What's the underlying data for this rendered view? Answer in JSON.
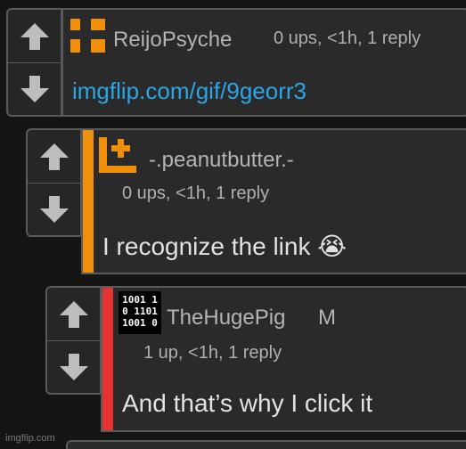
{
  "comments": [
    {
      "username": "ReijoPsyche",
      "meta": "0 ups, <1h, 1 reply",
      "text": "imgflip.com/gif/9georr3",
      "text_is_link": true,
      "avatar": "orange-blocks-icon",
      "accent_color": "#f0900a"
    },
    {
      "username": "-.peanutbutter.-",
      "meta": "0 ups, <1h, 1 reply",
      "text": "I recognize the link",
      "emoji": "😭",
      "avatar": "orange-plus-icon",
      "accent_color": "#f0900a"
    },
    {
      "username": "TheHugePig",
      "mod_badge": "M",
      "meta": "1 up, <1h, 1 reply",
      "text": "And that’s why I click it",
      "avatar": "binary-pixel-icon",
      "accent_color": "#e83232"
    }
  ],
  "watermark": "imgflip.com"
}
